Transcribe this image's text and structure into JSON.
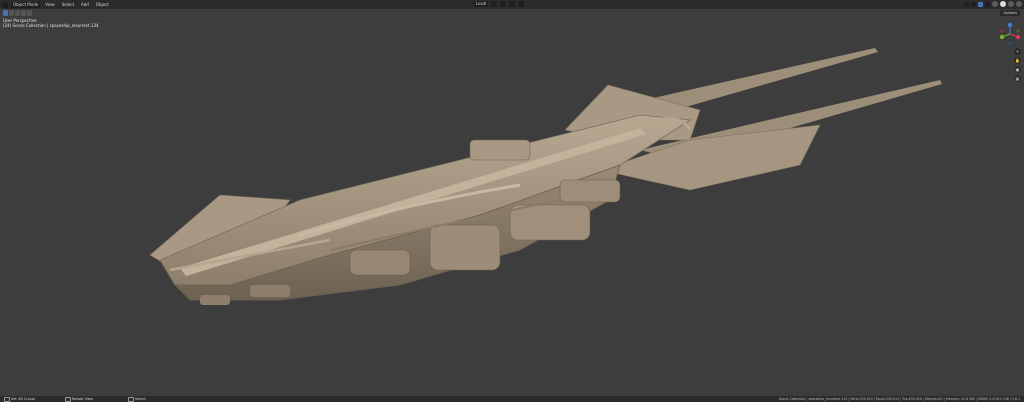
{
  "header": {
    "mode_label": "Object Mode",
    "menus": [
      "View",
      "Select",
      "Add",
      "Object"
    ],
    "transform_orientation": "Local"
  },
  "viewport": {
    "perspective_label": "User Perspective",
    "collection_label": "(24) Scene Collection | spaceship_resurrect.134",
    "options_label": "Options",
    "active_shading": "solid"
  },
  "gizmo": {
    "axes": [
      "x",
      "y",
      "z"
    ],
    "colors": {
      "x": "#e0394e",
      "y": "#77b22b",
      "z": "#3d82d6"
    }
  },
  "nav_icons": [
    "zoom-icon",
    "hand-icon",
    "camera-icon",
    "grid-icon"
  ],
  "statusbar": {
    "items": [
      "Set 3D Cursor",
      "Rotate View",
      "Select"
    ],
    "stats": "Scene Collection | spaceship_resurrect.134 | Verts:239,013 | Faces:239,013 | Tris:478,026 | Objects:0/1 | Memory: 12.6 GiB | VRAM: 0.4/16.0 GiB | 3.6.1"
  },
  "colors": {
    "background": "#3d3d3d",
    "header": "#2b2b2b",
    "model": "#a89884",
    "accent": "#4772b3"
  }
}
